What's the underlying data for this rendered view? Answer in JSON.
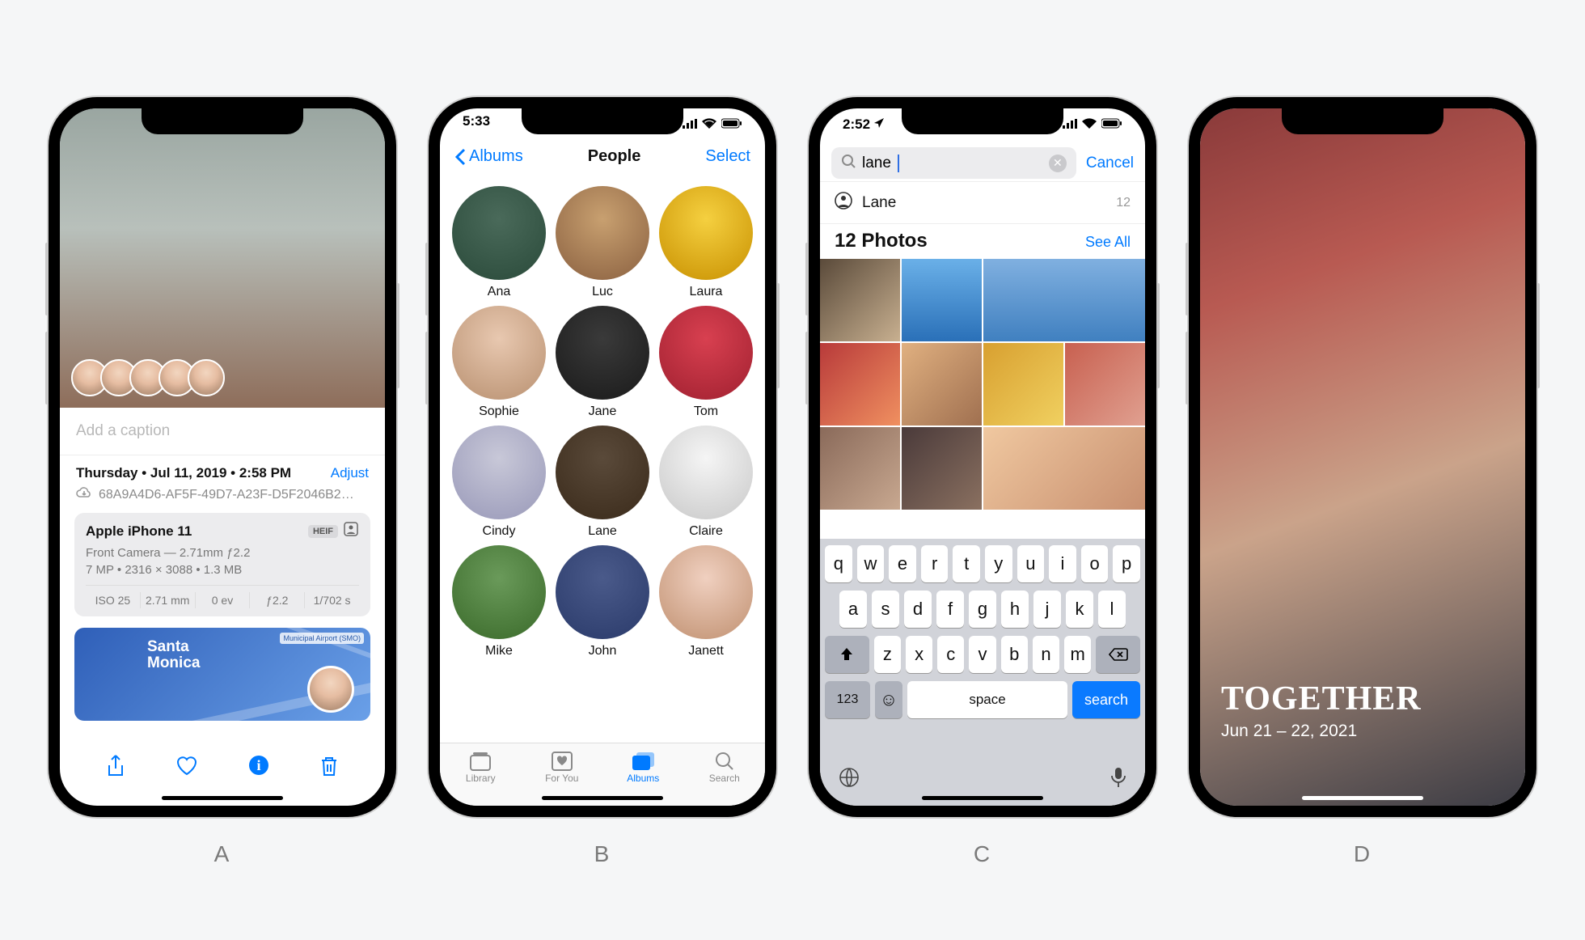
{
  "labels": [
    "A",
    "B",
    "C",
    "D"
  ],
  "status": {
    "timeB": "5:33",
    "timeC": "2:52"
  },
  "phoneA": {
    "caption_placeholder": "Add a caption",
    "date": "Thursday • Jul 11, 2019 • 2:58 PM",
    "adjust": "Adjust",
    "cloud_id": "68A9A4D6-AF5F-49D7-A23F-D5F2046B2…",
    "device": "Apple iPhone 11",
    "heif_badge": "HEIF",
    "camera": "Front Camera — 2.71mm ƒ2.2",
    "meta2": "7 MP  •  2316 × 3088  •  1.3 MB",
    "exif": {
      "iso": "ISO 25",
      "focal": "2.71 mm",
      "ev": "0 ev",
      "aperture": "ƒ2.2",
      "shutter": "1/702 s"
    },
    "map_label_l1": "Santa",
    "map_label_l2": "Monica",
    "map_airport": "Municipal Airport (SMO)",
    "face_count": 5
  },
  "phoneB": {
    "back": "Albums",
    "title": "People",
    "select": "Select",
    "people": [
      "Ana",
      "Luc",
      "Laura",
      "Sophie",
      "Jane",
      "Tom",
      "Cindy",
      "Lane",
      "Claire",
      "Mike",
      "John",
      "Janett"
    ],
    "tabs": [
      "Library",
      "For You",
      "Albums",
      "Search"
    ],
    "active_tab": "Albums"
  },
  "phoneC": {
    "query": "lane",
    "cancel": "Cancel",
    "suggest_label": "Lane",
    "suggest_count": "12",
    "section_title": "12 Photos",
    "see_all": "See All",
    "keyboard_rows": [
      [
        "q",
        "w",
        "e",
        "r",
        "t",
        "y",
        "u",
        "i",
        "o",
        "p"
      ],
      [
        "a",
        "s",
        "d",
        "f",
        "g",
        "h",
        "j",
        "k",
        "l"
      ],
      [
        "z",
        "x",
        "c",
        "v",
        "b",
        "n",
        "m"
      ]
    ],
    "numkey": "123",
    "space": "space",
    "search": "search"
  },
  "phoneD": {
    "title": "TOGETHER",
    "subtitle": "Jun 21 – 22, 2021"
  }
}
